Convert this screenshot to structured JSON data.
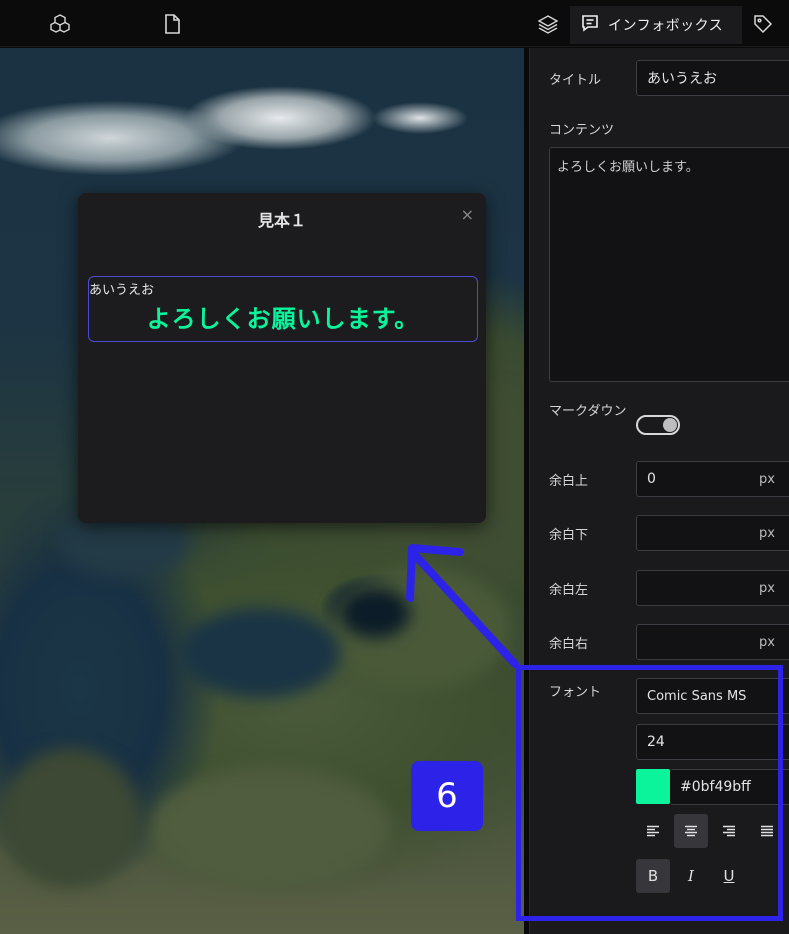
{
  "toolbar": {
    "icons": [
      "cubes-icon",
      "file-icon",
      "layers-icon",
      "tag-icon"
    ],
    "active_tab": {
      "label": "インフォボックス",
      "icon": "infobox-icon"
    }
  },
  "popup": {
    "title": "見本１",
    "close": "×",
    "card_title": "あいうえお",
    "card_content": "よろしくお願いします。",
    "content_color": "#0bf49b"
  },
  "panel": {
    "title_label": "タイトル",
    "title_value": "あいうえお",
    "contents_label": "コンテンツ",
    "contents_value": "よろしくお願いします。",
    "markdown_label": "マークダウン",
    "markdown_on": true,
    "margins": [
      {
        "label": "余白上",
        "value": "0",
        "unit": "px"
      },
      {
        "label": "余白下",
        "value": "",
        "unit": "px"
      },
      {
        "label": "余白左",
        "value": "",
        "unit": "px"
      },
      {
        "label": "余白右",
        "value": "",
        "unit": "px"
      }
    ],
    "font_label": "フォント",
    "font_family": "Comic Sans MS",
    "font_size": "24",
    "font_color": "#0bf49bff",
    "alignments": [
      "align-left",
      "align-center",
      "align-right",
      "align-justify"
    ],
    "active_alignment": "align-center",
    "styles": {
      "bold": "B",
      "italic": "I",
      "underline": "U"
    }
  },
  "annotation": {
    "step_number": "6",
    "color": "#2d23e8"
  }
}
